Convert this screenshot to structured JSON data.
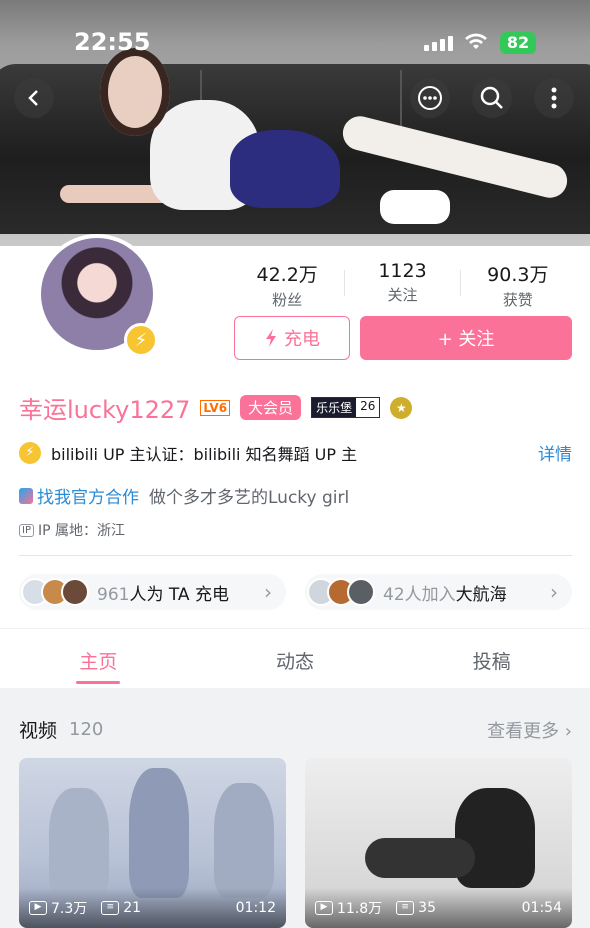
{
  "status_bar": {
    "time": "22:55",
    "battery": "82"
  },
  "nav": {
    "back_icon": "chevron-left-icon",
    "message_icon": "chat-bubble-icon",
    "search_icon": "search-icon",
    "more_icon": "more-vertical-icon"
  },
  "stats": [
    {
      "value": "42.2万",
      "label": "粉丝"
    },
    {
      "value": "1123",
      "label": "关注"
    },
    {
      "value": "90.3万",
      "label": "获赞"
    }
  ],
  "buttons": {
    "charge": "充电",
    "follow": "+ 关注"
  },
  "profile": {
    "name": "幸运lucky1227",
    "level": "LV6",
    "vip": "大会员",
    "medal_name": "乐乐堡",
    "medal_level": "26"
  },
  "verify": {
    "text": "bilibili UP 主认证：bilibili 知名舞蹈 UP 主",
    "detail": "详情"
  },
  "bio": {
    "link": "找我官方合作",
    "text": "做个多才多艺的Lucky girl"
  },
  "ip": {
    "tag": "IP",
    "text": "IP 属地：浙江"
  },
  "pills": [
    {
      "count": "961",
      "text": "人为 TA 充电"
    },
    {
      "count": "42",
      "text": "人加入",
      "suffix": "大航海"
    }
  ],
  "tabs": [
    "主页",
    "动态",
    "投稿"
  ],
  "videos_section": {
    "title": "视频",
    "count": "120",
    "more": "查看更多"
  },
  "videos": [
    {
      "views": "7.3万",
      "comments": "21",
      "duration": "01:12"
    },
    {
      "views": "11.8万",
      "comments": "35",
      "duration": "01:54"
    }
  ],
  "colors": {
    "accent": "#fb7299",
    "link": "#2c8bd6"
  }
}
